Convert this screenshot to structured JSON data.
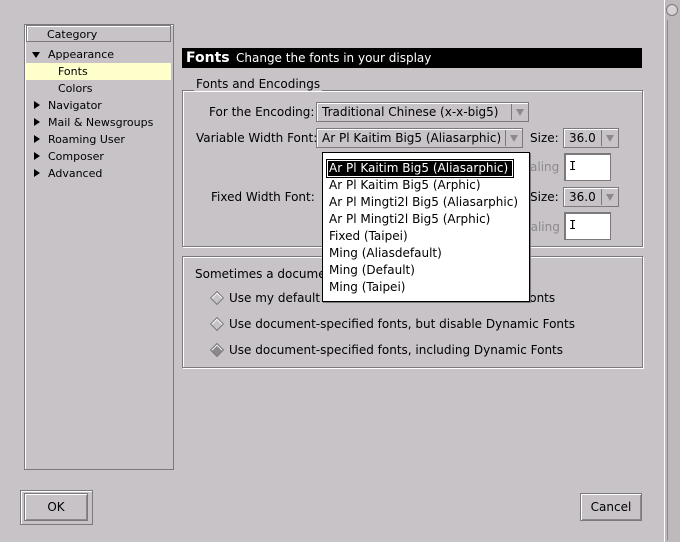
{
  "tree": {
    "header": "Category",
    "items": [
      {
        "label": "Appearance",
        "expanded": true
      },
      {
        "label": "Fonts",
        "selected": true
      },
      {
        "label": "Colors"
      },
      {
        "label": "Navigator"
      },
      {
        "label": "Mail & Newsgroups"
      },
      {
        "label": "Roaming User"
      },
      {
        "label": "Composer"
      },
      {
        "label": "Advanced"
      }
    ]
  },
  "header": {
    "title": "Fonts",
    "subtitle": "Change the fonts in your display"
  },
  "fonts_group": {
    "title": "Fonts and Encodings",
    "encoding_label": "For the Encoding:",
    "encoding_value": "Traditional Chinese (x-x-big5)",
    "variable_label": "Variable Width Font:",
    "variable_value": "Ar Pl Kaitim Big5 (Aliasarphic)",
    "size_label": "Size:",
    "variable_size": "36.0",
    "scaling_label_partial": "aling",
    "fixed_label": "Fixed Width Font:",
    "fixed_size": "36.0",
    "fixed_scaling_partial": "caling"
  },
  "dropdown": {
    "options": [
      "Ar Pl Kaitim Big5 (Aliasarphic)",
      "Ar Pl Kaitim Big5 (Arphic)",
      "Ar Pl Mingti2l Big5 (Aliasarphic)",
      "Ar Pl Mingti2l Big5 (Arphic)",
      "Fixed (Taipei)",
      "Ming (Aliasdefault)",
      "Ming (Default)",
      "Ming (Taipei)"
    ],
    "selected_index": 0
  },
  "doc_group": {
    "title_partial": "Sometimes a docume",
    "options": [
      {
        "left": "Use my default",
        "right": "fonts",
        "checked": false
      },
      {
        "label": "Use document-specified fonts, but disable Dynamic Fonts",
        "checked": false
      },
      {
        "label": "Use document-specified fonts, including Dynamic Fonts",
        "checked": true
      }
    ]
  },
  "buttons": {
    "ok": "OK",
    "cancel": "Cancel"
  }
}
